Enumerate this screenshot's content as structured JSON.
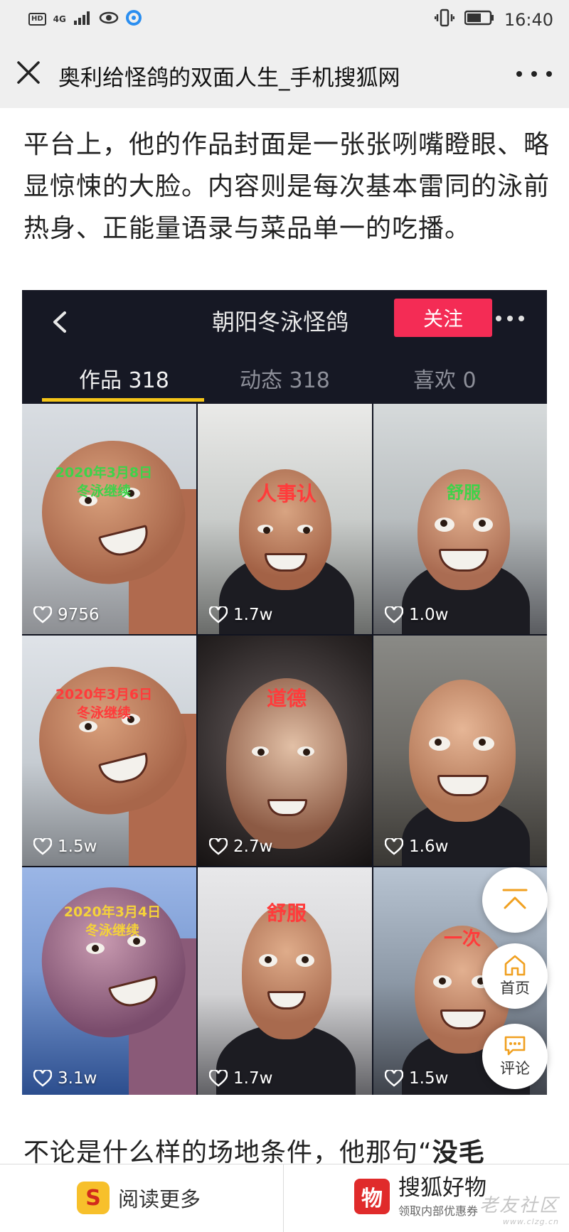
{
  "status_bar": {
    "hd": "HD",
    "network": "4G",
    "time": "16:40",
    "icons": [
      "signal-icon",
      "eye-icon",
      "browser-icon",
      "vibrate-icon",
      "battery-icon"
    ]
  },
  "header": {
    "title": "奥利给怪鸽的双面人生_手机搜狐网",
    "icons": [
      "close-icon",
      "more-icon"
    ]
  },
  "article": {
    "para1": "平台上，他的作品封面是一张张咧嘴瞪眼、略显惊悚的大脸。内容则是每次基本雷同的泳前热身、正能量语录与菜品单一的吃播。",
    "para2_start": "不论是什么样的场地条件，他那句“",
    "para2_bold": "没毛"
  },
  "embed": {
    "profile_name": "朝阳冬泳怪鸽",
    "follow_label": "关注",
    "tabs": [
      {
        "label": "作品 318"
      },
      {
        "label": "动态 318"
      },
      {
        "label": "喜欢 0"
      }
    ],
    "videos": [
      {
        "caption": "2020年3月8日\n冬泳继续",
        "caption_color": "#3fd24a",
        "likes": "9756"
      },
      {
        "caption": "人事认",
        "caption_color": "#ff3b3b",
        "likes": "1.7w"
      },
      {
        "caption": "舒服",
        "caption_color": "#3fd24a",
        "likes": "1.0w"
      },
      {
        "caption": "2020年3月6日\n冬泳继续",
        "caption_color": "#ff3b3b",
        "likes": "1.5w"
      },
      {
        "caption": "道德",
        "caption_color": "#ff3b3b",
        "likes": "2.7w"
      },
      {
        "caption": "",
        "caption_color": "#ffffff",
        "likes": "1.6w"
      },
      {
        "caption": "2020年3月4日\n冬泳继续",
        "caption_color": "#f5d23a",
        "likes": "3.1w"
      },
      {
        "caption": "舒服",
        "caption_color": "#ff3b3b",
        "likes": "1.7w"
      },
      {
        "caption": "一次",
        "caption_color": "#ff3b3b",
        "likes": "1.5w"
      }
    ]
  },
  "floating": {
    "home_label": "首页",
    "comment_label": "评论"
  },
  "bottom_bar": {
    "left_label": "阅读更多",
    "left_logo": "S",
    "right_logo": "物",
    "right_title": "搜狐好物",
    "right_sub": "领取内部优惠券"
  },
  "watermark": {
    "text": "老友社区",
    "url": "www.clzg.cn"
  }
}
